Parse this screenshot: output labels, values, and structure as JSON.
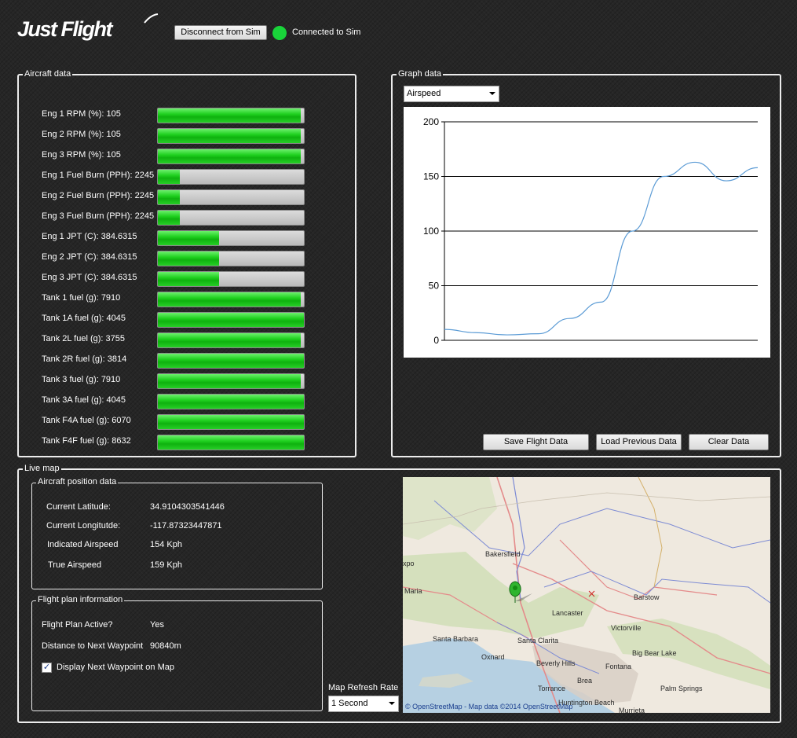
{
  "header": {
    "logo_text": "Just Flight",
    "disconnect_label": "Disconnect from Sim",
    "status_text": "Connected to Sim",
    "status_color": "#19d43a"
  },
  "aircraft": {
    "title": "Aircraft data",
    "rows": [
      {
        "label": "Eng 1 RPM (%): 105",
        "fill": 0.98
      },
      {
        "label": "Eng 2 RPM (%): 105",
        "fill": 0.98
      },
      {
        "label": "Eng 3 RPM (%): 105",
        "fill": 0.98
      },
      {
        "label": "Eng 1 Fuel Burn (PPH): 2245",
        "fill": 0.15
      },
      {
        "label": "Eng 2 Fuel Burn (PPH): 2245",
        "fill": 0.15
      },
      {
        "label": "Eng 3 Fuel Burn (PPH): 2245",
        "fill": 0.15
      },
      {
        "label": "Eng 1 JPT (C): 384.6315",
        "fill": 0.42
      },
      {
        "label": "Eng 2 JPT (C): 384.6315",
        "fill": 0.42
      },
      {
        "label": "Eng 3 JPT (C): 384.6315",
        "fill": 0.42
      },
      {
        "label": "Tank 1 fuel (g): 7910",
        "fill": 0.98
      },
      {
        "label": "Tank 1A fuel (g): 4045",
        "fill": 1.0
      },
      {
        "label": "Tank 2L fuel (g): 3755",
        "fill": 0.98
      },
      {
        "label": "Tank 2R fuel (g): 3814",
        "fill": 1.0
      },
      {
        "label": "Tank 3 fuel (g): 7910",
        "fill": 0.98
      },
      {
        "label": "Tank 3A fuel (g): 4045",
        "fill": 1.0
      },
      {
        "label": "Tank F4A fuel (g): 6070",
        "fill": 1.0
      },
      {
        "label": "Tank F4F fuel (g): 8632",
        "fill": 1.0
      }
    ]
  },
  "graph": {
    "title": "Graph data",
    "selected": "Airspeed",
    "save_label": "Save Flight Data",
    "load_label": "Load Previous Data",
    "clear_label": "Clear Data"
  },
  "chart_data": {
    "type": "line",
    "ylim": [
      0,
      200
    ],
    "yticks": [
      0,
      50,
      100,
      150,
      200
    ],
    "ytick_labels": [
      "0",
      "50",
      "100",
      "150",
      "200"
    ],
    "x": [
      0,
      1,
      2,
      3,
      4,
      5,
      6,
      7,
      8,
      9,
      10
    ],
    "series": [
      {
        "values": [
          10,
          7,
          5,
          6,
          20,
          35,
          100,
          150,
          163,
          146,
          158
        ],
        "color": "#5b9bd5"
      }
    ]
  },
  "livemap": {
    "title": "Live map",
    "position": {
      "title": "Aircraft position data",
      "rows": [
        {
          "label": "Current Latitude:",
          "value": "34.9104303541446"
        },
        {
          "label": "Current Longitutde:",
          "value": "-117.87323447871"
        },
        {
          "label": "Indicated Airspeed",
          "value": "154 Kph"
        },
        {
          "label": "True Airspeed",
          "value": "159 Kph"
        }
      ]
    },
    "plan": {
      "title": "Flight plan information",
      "active_label": "Flight Plan Active?",
      "active_value": "Yes",
      "distance_label": "Distance to Next Waypoint",
      "distance_value": "90840m",
      "checkbox_label": "Display Next Waypoint on Map",
      "checkbox_checked": true
    },
    "refresh": {
      "label": "Map Refresh Rate",
      "value": "1 Second"
    },
    "map": {
      "attribution": "© OpenStreetMap - Map data ©2014 OpenStreetMap",
      "places": [
        "Bakersfield",
        "Maria",
        "Barstow",
        "Lancaster",
        "Victorville",
        "Santa Barbara",
        "Santa Clarita",
        "Oxnard",
        "Big Bear Lake",
        "Beverly Hills",
        "Fontana",
        "Brea",
        "Torrance",
        "Palm Springs",
        "Huntington Beach",
        "Murrieta",
        "xpo"
      ]
    }
  }
}
